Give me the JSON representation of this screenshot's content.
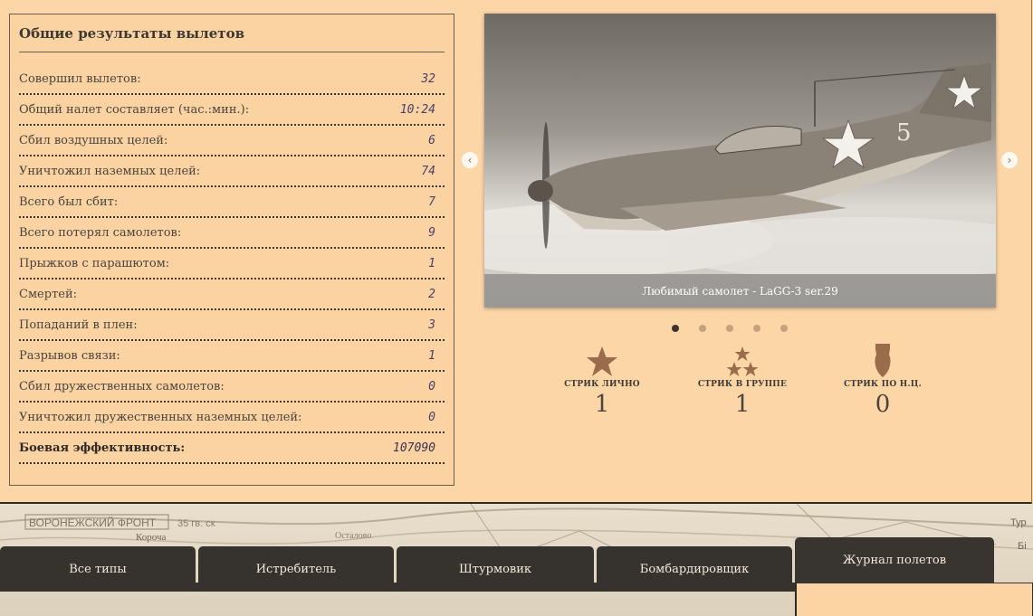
{
  "stats": {
    "title": "Общие результаты вылетов",
    "rows": [
      {
        "label": "Совершил вылетов:",
        "value": "32"
      },
      {
        "label": "Общий налет составляет (час.:мин.):",
        "value": "10:24"
      },
      {
        "label": "Сбил воздушных целей:",
        "value": "6"
      },
      {
        "label": "Уничтожил наземных целей:",
        "value": "74"
      },
      {
        "label": "Всего был сбит:",
        "value": "7"
      },
      {
        "label": "Всего потерял самолетов:",
        "value": "9"
      },
      {
        "label": "Прыжков с парашютом:",
        "value": "1"
      },
      {
        "label": "Смертей:",
        "value": "2"
      },
      {
        "label": "Попаданий в плен:",
        "value": "3"
      },
      {
        "label": "Разрывов связи:",
        "value": "1"
      },
      {
        "label": "Сбил дружественных самолетов:",
        "value": "0"
      },
      {
        "label": "Уничтожил дружественных наземных целей:",
        "value": "0"
      },
      {
        "label": "Боевая эффективность:",
        "value": "107090"
      }
    ]
  },
  "slider": {
    "caption": "Любимый самолет - LaGG-3 ser.29",
    "aircraft_number": "5",
    "prev_icon": "chevron-left-icon",
    "next_icon": "chevron-right-icon",
    "prev_glyph": "‹",
    "next_glyph": "›",
    "slide_count": 5,
    "active_slide": 1
  },
  "map": {
    "front_label": "ВОРОНЕЖСКИЙ ФРОНТ",
    "army_label": "35 гв. ск",
    "town_label": "Короча",
    "town2_label": "Осталово",
    "right_label": "Тур",
    "right_label2": "Бі"
  },
  "streaks": [
    {
      "icon": "star-icon",
      "label": "СТРИК ЛИЧНО",
      "value": "1"
    },
    {
      "icon": "three-stars-icon",
      "label": "СТРИК В ГРУППЕ",
      "value": "1"
    },
    {
      "icon": "bomb-icon",
      "label": "СТРИК ПО Н.Ц.",
      "value": "0"
    }
  ],
  "tabs": [
    {
      "label": "Все типы",
      "active": false
    },
    {
      "label": "Истребитель",
      "active": false
    },
    {
      "label": "Штурмовик",
      "active": false
    },
    {
      "label": "Бомбардировщик",
      "active": false
    },
    {
      "label": "Журнал полетов",
      "active": true
    }
  ],
  "colors": {
    "page_bg": "#fcd4a4",
    "tab_bg": "#36322d",
    "icon_brown": "#9a6c4c",
    "dot_active": "#3b3630",
    "dot_inactive": "#c5a27e"
  }
}
